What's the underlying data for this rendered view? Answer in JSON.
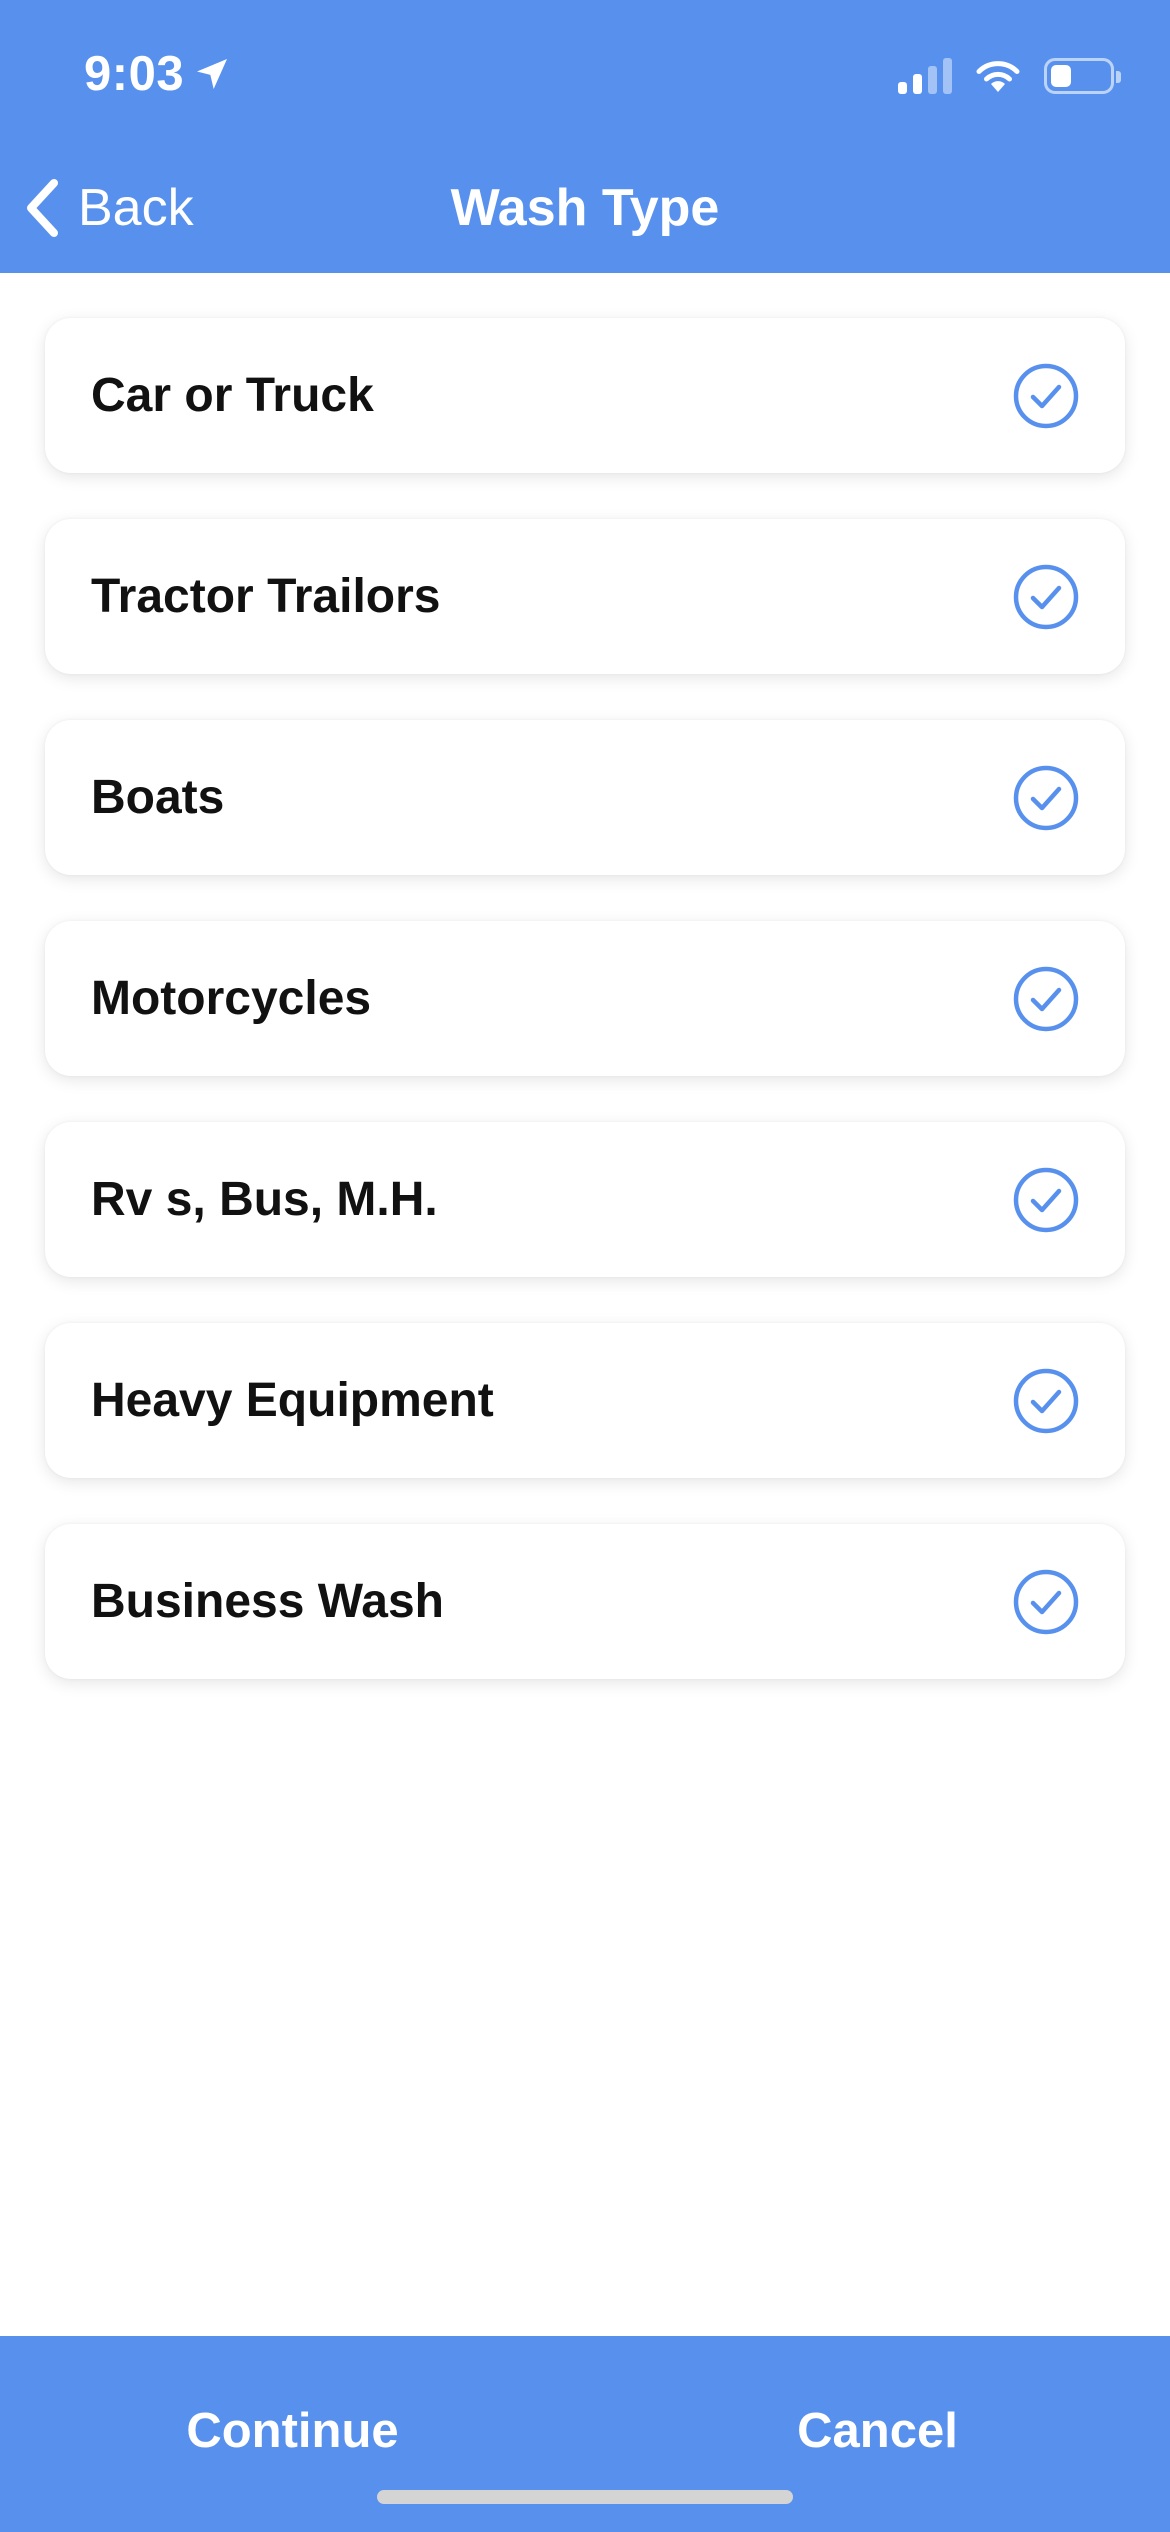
{
  "status_bar": {
    "time": "9:03",
    "location_icon": "location-arrow-icon",
    "signal_icon": "cellular-signal-icon",
    "wifi_icon": "wifi-icon",
    "battery_icon": "battery-icon",
    "battery_level": 0.35
  },
  "nav": {
    "back_label": "Back",
    "back_icon": "chevron-left-icon",
    "title": "Wash Type"
  },
  "wash_types": [
    {
      "label": "Car or Truck",
      "icon": "check-circle-icon",
      "checked": true
    },
    {
      "label": "Tractor Trailors",
      "icon": "check-circle-icon",
      "checked": true
    },
    {
      "label": "Boats",
      "icon": "check-circle-icon",
      "checked": true
    },
    {
      "label": "Motorcycles",
      "icon": "check-circle-icon",
      "checked": true
    },
    {
      "label": "Rv s, Bus, M.H.",
      "icon": "check-circle-icon",
      "checked": true
    },
    {
      "label": "Heavy Equipment",
      "icon": "check-circle-icon",
      "checked": true
    },
    {
      "label": "Business Wash",
      "icon": "check-circle-icon",
      "checked": true
    }
  ],
  "toolbar": {
    "continue_label": "Continue",
    "cancel_label": "Cancel"
  },
  "colors": {
    "accent": "#5891ED",
    "text": "#111111",
    "background": "#FFFFFF"
  }
}
